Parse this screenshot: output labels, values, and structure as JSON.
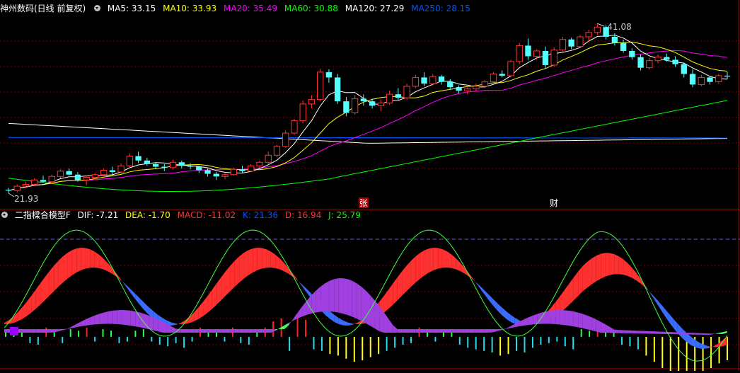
{
  "header_top": {
    "title": "神州数码(日线 前复权)",
    "items": [
      {
        "label": "MA5: 33.15",
        "color": "#ffffff"
      },
      {
        "label": "MA10: 33.93",
        "color": "#ffff00"
      },
      {
        "label": "MA20: 35.49",
        "color": "#ff00ff"
      },
      {
        "label": "MA60: 30.88",
        "color": "#00ff00"
      },
      {
        "label": "MA120: 27.29",
        "color": "#ffffff"
      },
      {
        "label": "MA250: 28.15",
        "color": "#0055ff"
      }
    ]
  },
  "header_bottom": {
    "title": "二指樑合模型F",
    "items": [
      {
        "label": "DIF: -7.21",
        "color": "#ffffff"
      },
      {
        "label": "DEA: -1.70",
        "color": "#ffff00"
      },
      {
        "label": "MACD: -11.02",
        "color": "#ff3333"
      },
      {
        "label": "K: 21.36",
        "color": "#0055ff"
      },
      {
        "label": "D: 16.94",
        "color": "#ff3333"
      },
      {
        "label": "J: 25.79",
        "color": "#00ff00"
      }
    ]
  },
  "chart_data": [
    {
      "type": "candlestick",
      "price_high_label": "41.08",
      "price_low_label": "21.93",
      "markers": [
        {
          "label": "张"
        },
        {
          "label": "财"
        }
      ],
      "colors": {
        "up": "#ff3333",
        "down": "#54ffff",
        "ma5": "#ffffff",
        "ma10": "#ffff00",
        "ma20": "#ff00ff",
        "ma60": "#00ff00",
        "ma120": "#ffffff",
        "ma250": "#0055ff"
      },
      "candles": [
        [
          22.3,
          22.5,
          21.9,
          22.2
        ],
        [
          22.2,
          22.9,
          22.0,
          22.7
        ],
        [
          22.7,
          23.2,
          22.5,
          22.9
        ],
        [
          22.9,
          23.6,
          22.7,
          23.4
        ],
        [
          23.4,
          23.9,
          23.1,
          23.2
        ],
        [
          23.2,
          24.0,
          23.0,
          23.8
        ],
        [
          23.8,
          24.6,
          23.6,
          24.4
        ],
        [
          24.4,
          24.7,
          23.9,
          24.0
        ],
        [
          24.0,
          24.3,
          23.2,
          23.4
        ],
        [
          23.4,
          23.9,
          22.8,
          23.7
        ],
        [
          23.7,
          24.2,
          23.4,
          24.0
        ],
        [
          24.0,
          24.7,
          23.8,
          24.5
        ],
        [
          24.5,
          24.9,
          24.0,
          24.3
        ],
        [
          24.3,
          25.3,
          24.1,
          25.0
        ],
        [
          25.0,
          26.4,
          24.8,
          26.1
        ],
        [
          26.1,
          26.6,
          25.3,
          25.6
        ],
        [
          25.6,
          25.9,
          25.0,
          25.2
        ],
        [
          25.2,
          25.4,
          24.6,
          24.9
        ],
        [
          24.9,
          25.2,
          24.4,
          24.8
        ],
        [
          24.8,
          25.7,
          24.6,
          25.4
        ],
        [
          25.4,
          25.6,
          24.7,
          25.0
        ],
        [
          25.0,
          25.3,
          24.6,
          24.9
        ],
        [
          24.9,
          25.0,
          24.2,
          24.5
        ],
        [
          24.5,
          24.7,
          23.8,
          24.1
        ],
        [
          24.1,
          24.3,
          23.4,
          23.8
        ],
        [
          23.8,
          24.2,
          23.5,
          24.0
        ],
        [
          24.0,
          24.8,
          23.9,
          24.6
        ],
        [
          24.6,
          25.0,
          24.2,
          24.4
        ],
        [
          24.4,
          25.2,
          24.3,
          25.0
        ],
        [
          25.0,
          25.6,
          24.7,
          25.4
        ],
        [
          25.4,
          26.6,
          25.2,
          26.2
        ],
        [
          26.2,
          27.4,
          26.0,
          27.2
        ],
        [
          27.2,
          29.0,
          27.0,
          28.7
        ],
        [
          28.7,
          30.3,
          28.5,
          30.1
        ],
        [
          30.1,
          32.4,
          29.8,
          32.0
        ],
        [
          32.0,
          33.0,
          31.5,
          32.5
        ],
        [
          32.5,
          36.0,
          32.3,
          35.6
        ],
        [
          35.6,
          35.9,
          34.4,
          35.0
        ],
        [
          35.0,
          35.4,
          32.0,
          32.3
        ],
        [
          32.3,
          32.8,
          30.6,
          31.0
        ],
        [
          31.0,
          33.0,
          30.8,
          32.6
        ],
        [
          32.6,
          33.1,
          31.8,
          32.3
        ],
        [
          32.3,
          32.6,
          31.5,
          31.8
        ],
        [
          31.8,
          32.5,
          31.2,
          32.1
        ],
        [
          32.1,
          33.5,
          31.9,
          33.1
        ],
        [
          33.1,
          33.8,
          32.4,
          32.7
        ],
        [
          32.7,
          34.3,
          32.5,
          34.0
        ],
        [
          34.0,
          35.3,
          33.8,
          35.0
        ],
        [
          35.0,
          35.6,
          34.0,
          34.3
        ],
        [
          34.3,
          35.4,
          34.1,
          35.1
        ],
        [
          35.1,
          35.3,
          34.2,
          34.5
        ],
        [
          34.5,
          34.8,
          33.6,
          33.9
        ],
        [
          33.9,
          34.1,
          33.2,
          33.5
        ],
        [
          33.5,
          34.0,
          33.1,
          33.7
        ],
        [
          33.7,
          34.3,
          33.4,
          34.0
        ],
        [
          34.0,
          34.7,
          33.8,
          34.5
        ],
        [
          34.5,
          35.6,
          34.3,
          35.4
        ],
        [
          35.4,
          35.8,
          35.0,
          35.2
        ],
        [
          35.2,
          37.0,
          35.0,
          36.8
        ],
        [
          36.8,
          38.9,
          36.5,
          38.6
        ],
        [
          38.6,
          39.4,
          37.0,
          37.4
        ],
        [
          37.4,
          38.2,
          37.0,
          38.0
        ],
        [
          38.0,
          38.5,
          36.0,
          36.4
        ],
        [
          36.4,
          38.4,
          36.2,
          38.1
        ],
        [
          38.1,
          39.6,
          37.9,
          39.3
        ],
        [
          39.3,
          39.5,
          38.2,
          38.5
        ],
        [
          38.5,
          39.8,
          38.3,
          39.6
        ],
        [
          39.6,
          40.4,
          39.0,
          40.1
        ],
        [
          40.1,
          41.1,
          39.8,
          40.7
        ],
        [
          40.7,
          40.9,
          39.3,
          39.6
        ],
        [
          39.6,
          40.0,
          38.6,
          38.9
        ],
        [
          38.9,
          39.3,
          37.8,
          38.0
        ],
        [
          38.0,
          38.3,
          37.0,
          37.3
        ],
        [
          37.3,
          37.6,
          35.8,
          36.1
        ],
        [
          36.1,
          37.2,
          35.9,
          36.9
        ],
        [
          36.9,
          37.6,
          36.6,
          37.3
        ],
        [
          37.3,
          37.7,
          36.8,
          37.0
        ],
        [
          37.0,
          37.4,
          36.2,
          36.5
        ],
        [
          36.5,
          36.7,
          35.0,
          35.4
        ],
        [
          35.4,
          35.9,
          33.9,
          34.2
        ],
        [
          34.2,
          35.3,
          34.0,
          35.0
        ],
        [
          35.0,
          35.2,
          34.2,
          34.5
        ],
        [
          34.5,
          35.4,
          34.3,
          35.2
        ],
        [
          35.2,
          35.6,
          34.8,
          35.1
        ]
      ],
      "ma250": [
        28.2,
        28.15
      ],
      "ma120": [
        27.2,
        27.29
      ]
    },
    {
      "type": "macd_kdj_composite",
      "dea_line": -1.7,
      "hist": [
        3,
        4,
        5,
        -4,
        -5,
        6,
        3,
        -4,
        5,
        4,
        6,
        -3,
        5,
        4,
        -4,
        -3,
        4,
        5,
        -3,
        -5,
        -6,
        -4,
        -7,
        -3,
        6,
        5,
        4,
        -3,
        6,
        -4,
        -5,
        4,
        6,
        10,
        12,
        -9,
        14,
        11,
        -8,
        -9,
        -11,
        -12,
        -14,
        -16,
        -15,
        -13,
        -11,
        -9,
        -7,
        -5,
        -4,
        6,
        4,
        -3,
        5,
        4,
        -5,
        -7,
        -8,
        -9,
        -10,
        -12,
        -11,
        -9,
        -10,
        -7,
        -5,
        -4,
        -3,
        -6,
        -8,
        5,
        4,
        6,
        3,
        4,
        -5,
        -6,
        -8,
        -12,
        -16,
        -20,
        -24,
        -27,
        -28,
        -26,
        -24,
        -20,
        -17,
        -15
      ],
      "j_line": [
        25.79
      ]
    }
  ]
}
